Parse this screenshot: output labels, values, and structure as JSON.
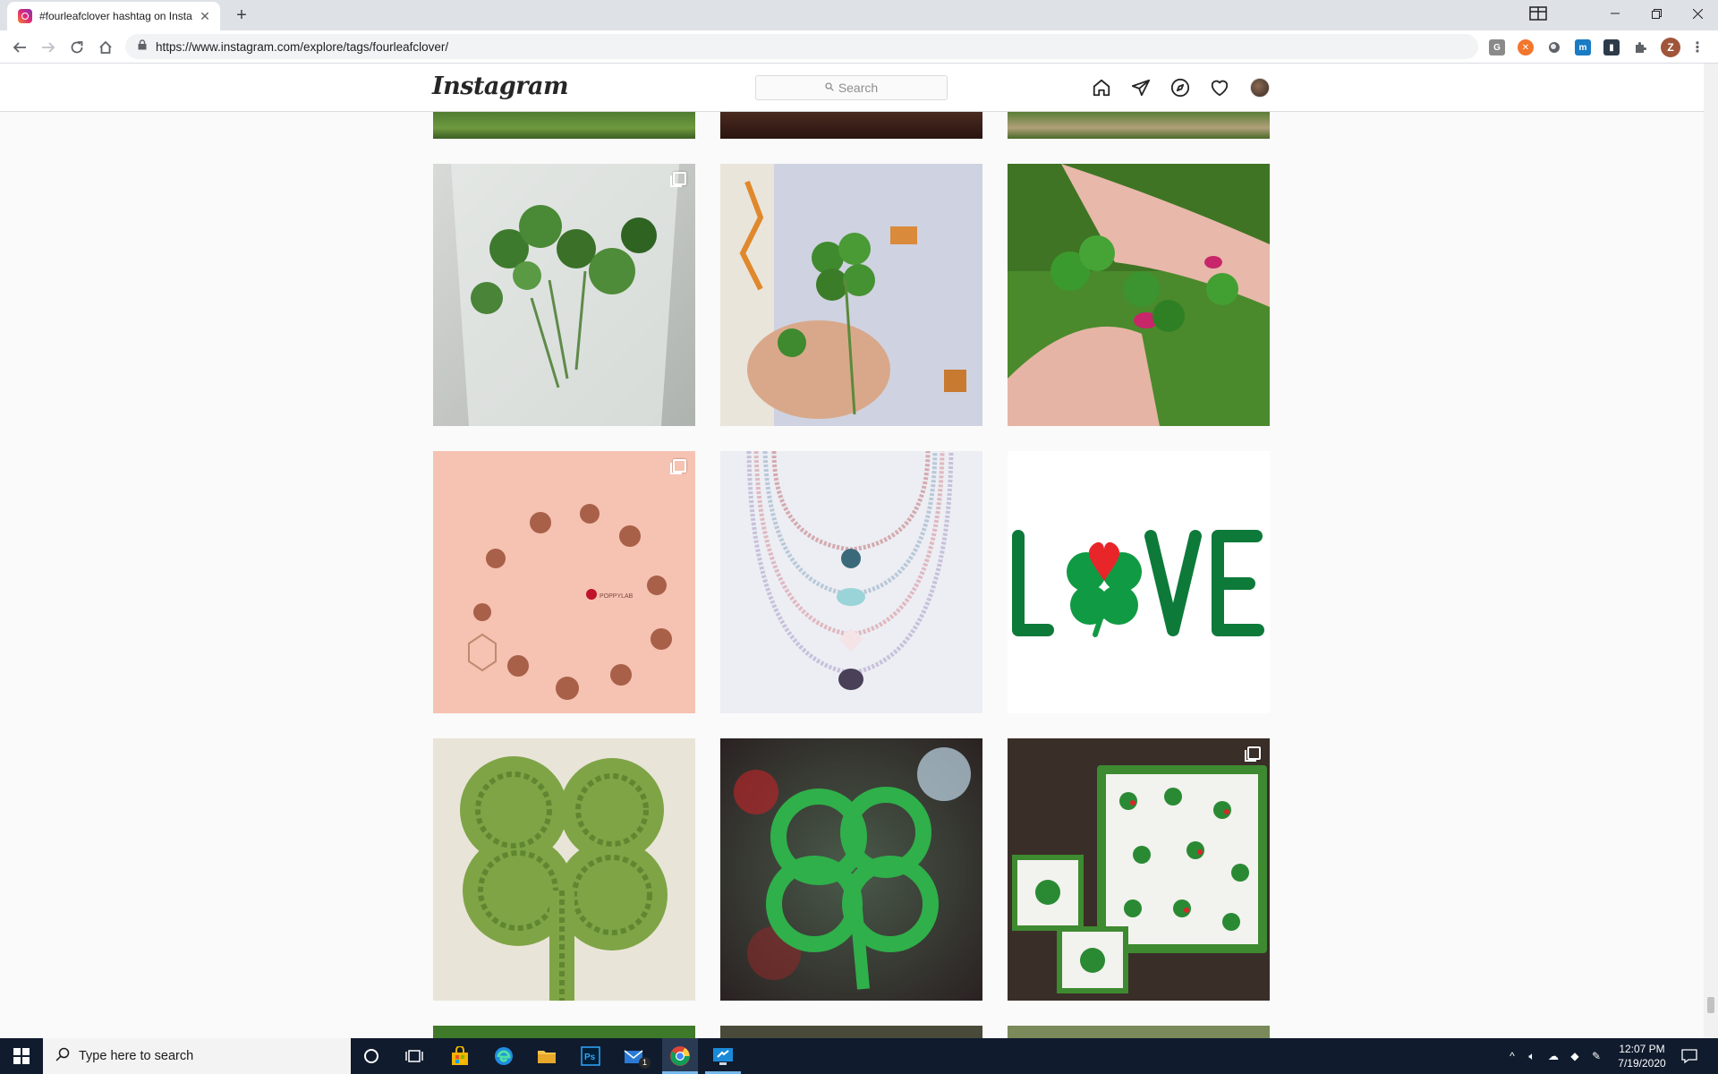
{
  "browser": {
    "tab_title": "#fourleafclover hashtag on Insta",
    "url": "https://www.instagram.com/explore/tags/fourleafclover/",
    "profile_initial": "Z"
  },
  "instagram": {
    "logo": "Instagram",
    "search_placeholder": "Search"
  },
  "posts": [
    {
      "row": 1,
      "col": 1,
      "subject": "clover sprigs in water glass",
      "multiple": true
    },
    {
      "row": 1,
      "col": 2,
      "subject": "hand holding four-leaf clover over fabric",
      "multiple": false
    },
    {
      "row": 1,
      "col": 3,
      "subject": "fingers holding clover in grass",
      "multiple": false
    },
    {
      "row": 2,
      "col": 1,
      "subject": "clover earrings on peach background",
      "multiple": true
    },
    {
      "row": 2,
      "col": 2,
      "subject": "beaded necklaces",
      "multiple": false
    },
    {
      "row": 2,
      "col": 3,
      "subject": "LOVE with clover graphic",
      "multiple": false,
      "text": "L VE"
    },
    {
      "row": 3,
      "col": 1,
      "subject": "knitted green clover",
      "multiple": false
    },
    {
      "row": 3,
      "col": 2,
      "subject": "painted clover outline",
      "multiple": false
    },
    {
      "row": 3,
      "col": 3,
      "subject": "clover patterned tray and coasters",
      "multiple": true
    }
  ],
  "taskbar": {
    "search_placeholder": "Type here to search",
    "time": "12:07 PM",
    "date": "7/19/2020",
    "mail_badge": "1"
  }
}
